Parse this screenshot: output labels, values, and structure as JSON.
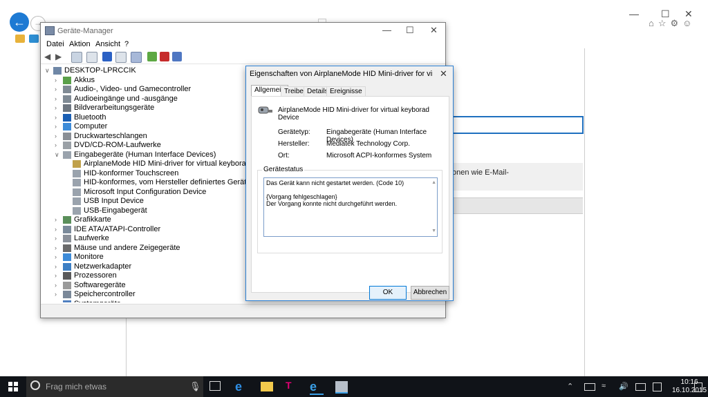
{
  "device_manager": {
    "title": "Geräte-Manager",
    "menu": [
      "Datei",
      "Aktion",
      "Ansicht",
      "?"
    ],
    "tree": [
      {
        "label": "DESKTOP-LPRCCIK",
        "level": 0,
        "expanded": true,
        "icon": "computer-icon"
      },
      {
        "label": "Akkus",
        "level": 1,
        "icon": "battery-icon"
      },
      {
        "label": "Audio-, Video- und Gamecontroller",
        "level": 1,
        "icon": "speaker-icon"
      },
      {
        "label": "Audioeingänge und -ausgänge",
        "level": 1,
        "icon": "speaker-icon"
      },
      {
        "label": "Bildverarbeitungsgeräte",
        "level": 1,
        "icon": "camera-icon"
      },
      {
        "label": "Bluetooth",
        "level": 1,
        "icon": "bluetooth-icon"
      },
      {
        "label": "Computer",
        "level": 1,
        "icon": "monitor-icon"
      },
      {
        "label": "Druckwarteschlangen",
        "level": 1,
        "icon": "printer-icon"
      },
      {
        "label": "DVD/CD-ROM-Laufwerke",
        "level": 1,
        "icon": "disc-drive-icon"
      },
      {
        "label": "Eingabegeräte (Human Interface Devices)",
        "level": 1,
        "expanded": true,
        "icon": "hid-icon"
      },
      {
        "label": "AirplaneMode HID Mini-driver for virtual keyborad Device",
        "level": 2,
        "icon": "hid-warning-icon"
      },
      {
        "label": "HID-konformer Touchscreen",
        "level": 2,
        "icon": "hid-icon"
      },
      {
        "label": "HID-konformes, vom Hersteller definiertes Gerät",
        "level": 2,
        "icon": "hid-icon"
      },
      {
        "label": "Microsoft Input Configuration Device",
        "level": 2,
        "icon": "hid-icon"
      },
      {
        "label": "USB Input Device",
        "level": 2,
        "icon": "hid-icon"
      },
      {
        "label": "USB-Eingabegerät",
        "level": 2,
        "icon": "hid-icon"
      },
      {
        "label": "Grafikkarte",
        "level": 1,
        "icon": "display-adapter-icon"
      },
      {
        "label": "IDE ATA/ATAPI-Controller",
        "level": 1,
        "icon": "ide-controller-icon"
      },
      {
        "label": "Laufwerke",
        "level": 1,
        "icon": "disk-icon"
      },
      {
        "label": "Mäuse und andere Zeigegeräte",
        "level": 1,
        "icon": "mouse-icon"
      },
      {
        "label": "Monitore",
        "level": 1,
        "icon": "monitor-icon"
      },
      {
        "label": "Netzwerkadapter",
        "level": 1,
        "icon": "network-adapter-icon"
      },
      {
        "label": "Prozessoren",
        "level": 1,
        "icon": "processor-icon"
      },
      {
        "label": "Softwaregeräte",
        "level": 1,
        "icon": "software-device-icon"
      },
      {
        "label": "Speichercontroller",
        "level": 1,
        "icon": "storage-controller-icon"
      },
      {
        "label": "Systemgeräte",
        "level": 1,
        "icon": "system-device-icon"
      }
    ]
  },
  "properties": {
    "title": "Eigenschaften von AirplaneMode HID Mini-driver for virtual keyb...",
    "tabs": [
      "Allgemein",
      "Treiber",
      "Details",
      "Ereignisse"
    ],
    "active_tab": "Allgemein",
    "device_name": "AirplaneMode HID Mini-driver for virtual keyborad Device",
    "fields": [
      {
        "label": "Gerätetyp:",
        "value": "Eingabegeräte (Human Interface Devices)"
      },
      {
        "label": "Hersteller:",
        "value": "Mediatek Technology Corp."
      },
      {
        "label": "Ort:",
        "value": "Microsoft ACPI-konformes System"
      }
    ],
    "status_legend": "Gerätestatus",
    "status_lines": [
      "Das Gerät kann nicht gestartet werden. (Code 10)",
      "",
      "{Vorgang fehlgeschlagen}",
      "Der Vorgang konnte nicht durchgeführt werden."
    ],
    "ok_label": "OK",
    "cancel_label": "Abbrechen"
  },
  "background_page": {
    "snippet": "onen wie E-Mail-"
  },
  "taskbar": {
    "search_placeholder": "Frag mich etwas",
    "time": "10:16",
    "date": "16.10.2015"
  },
  "colors": {
    "accent": "#0078d7",
    "taskbar": "#101318",
    "dialog_bg": "#f0f0f0"
  }
}
